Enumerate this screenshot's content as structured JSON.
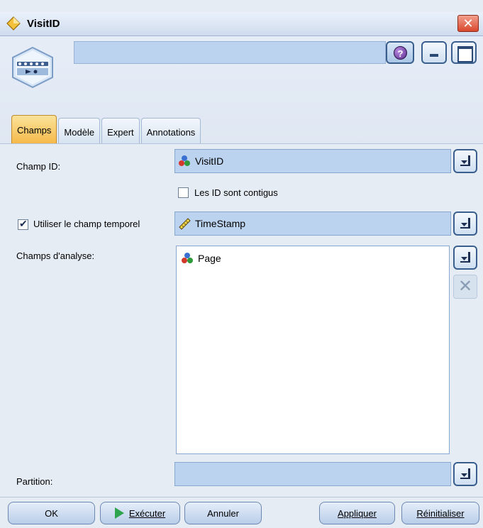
{
  "window": {
    "title": "VisitID"
  },
  "header": {
    "help_label": "?"
  },
  "tabs": [
    {
      "label": "Champs",
      "active": true
    },
    {
      "label": "Modèle",
      "active": false
    },
    {
      "label": "Expert",
      "active": false
    },
    {
      "label": "Annotations",
      "active": false
    }
  ],
  "form": {
    "id_field_label": "Champ ID:",
    "id_field_value": "VisitID",
    "contiguous_label": "Les ID sont contigus",
    "contiguous_checked": false,
    "use_time_label": "Utiliser le champ temporel",
    "use_time_checked": true,
    "time_field_value": "TimeStamp",
    "analysis_label": "Champs d'analyse:",
    "analysis_items": [
      "Page"
    ],
    "partition_label": "Partition:",
    "partition_value": ""
  },
  "buttons": {
    "ok": "OK",
    "run": "Exécuter",
    "cancel": "Annuler",
    "apply": "Appliquer",
    "reset": "Réinitialiser"
  },
  "icons": {
    "node": "sequence-node-icon",
    "nominal_field": "nominal-field-icon",
    "timestamp_field": "ruler-icon"
  },
  "colors": {
    "active_tab": "#f5b94a",
    "field_bg": "#bcd3ef",
    "close_button": "#d9482d"
  }
}
